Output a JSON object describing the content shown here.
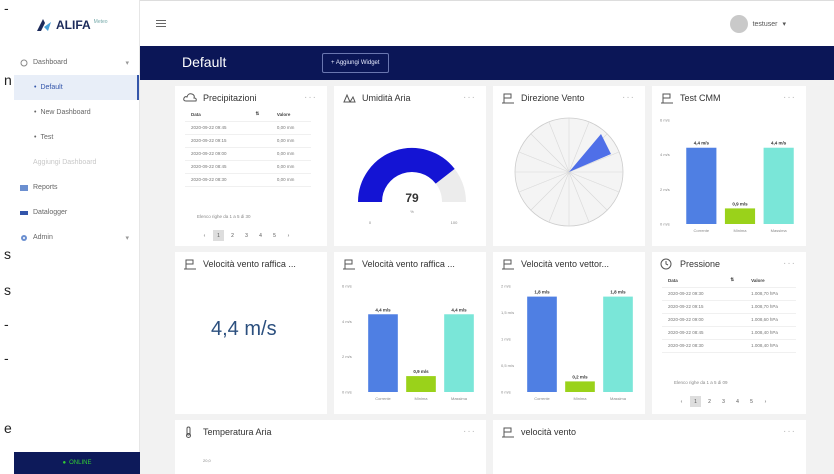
{
  "edge_glyphs": [
    "-",
    "n",
    "s",
    "s",
    "-",
    "-",
    "e"
  ],
  "brand": {
    "name": "ALIFA",
    "sup": "Meteo"
  },
  "sidebar": {
    "items": [
      {
        "label": "Dashboard",
        "icon": "dashboard-icon",
        "has_chevron": true
      },
      {
        "label": "Default",
        "active": true
      },
      {
        "label": "New Dashboard"
      },
      {
        "label": "Test"
      },
      {
        "label": "Aggiungi Dashboard",
        "disabled": true
      },
      {
        "label": "Reports",
        "icon": "reports-icon"
      },
      {
        "label": "Datalogger",
        "icon": "datalogger-icon"
      },
      {
        "label": "Admin",
        "icon": "admin-icon",
        "has_chevron": true
      }
    ],
    "status": "ONLINE"
  },
  "topbar": {
    "user": "testuser",
    "user_caret": "▾"
  },
  "dashboard": {
    "title": "Default",
    "add_widget": "+ Aggiungi Widget"
  },
  "widgets": {
    "precipitazioni": {
      "title": "Precipitazioni",
      "columns": [
        "Data",
        "Valore"
      ],
      "rows": [
        [
          "2020-09-22 09:45",
          "0,00 mm"
        ],
        [
          "2020-09-22 09:15",
          "0,00 mm"
        ],
        [
          "2020-09-22 09:00",
          "0,00 mm"
        ],
        [
          "2020-09-22 08:45",
          "0,00 mm"
        ],
        [
          "2020-09-22 08:30",
          "0,00 mm"
        ]
      ],
      "info": "Elenco righe da 1 a 5 di 30",
      "pages": [
        "‹",
        "1",
        "2",
        "3",
        "4",
        "5",
        "›"
      ]
    },
    "umidita": {
      "title": "Umidità Aria",
      "value": "79",
      "unit": "%",
      "min": "0",
      "max": "100",
      "gauge_fraction": 0.79
    },
    "direzione": {
      "title": "Direzione Vento"
    },
    "test_cmm": {
      "title": "Test CMM",
      "bar_labels": [
        "4,4 m/s",
        "0,9 m/s",
        "4,4 m/s"
      ],
      "categories": [
        "Corrente",
        "Minima",
        "Massima"
      ],
      "yticks": [
        "6 m/s",
        "4 m/s",
        "2 m/s",
        "0 m/s"
      ]
    },
    "raffica1": {
      "title": "Velocità vento raffica ...",
      "value": "4,4 m/s"
    },
    "raffica2": {
      "title": "Velocità vento raffica ...",
      "bar_labels": [
        "4,4 m/s",
        "0,9 m/s",
        "4,4 m/s"
      ],
      "categories": [
        "Corrente",
        "Minima",
        "Massima"
      ],
      "yticks": [
        "6 m/s",
        "4 m/s",
        "2 m/s",
        "0 m/s"
      ]
    },
    "vettore": {
      "title": "Velocità vento vettor...",
      "bar_labels": [
        "1,8 m/s",
        "0,2 m/s",
        "1,8 m/s"
      ],
      "categories": [
        "Corrente",
        "Minima",
        "Massima"
      ],
      "yticks": [
        "2 m/s",
        "1,5 m/s",
        "1 m/s",
        "0,5 m/s",
        "0 m/s"
      ]
    },
    "pressione": {
      "title": "Pressione",
      "columns": [
        "Data",
        "Valore"
      ],
      "rows": [
        [
          "2020-09-22 09:30",
          "1.008,70 hPa"
        ],
        [
          "2020-09-22 09:15",
          "1.008,70 hPa"
        ],
        [
          "2020-09-22 09:00",
          "1.008,60 hPa"
        ],
        [
          "2020-09-22 08:45",
          "1.008,40 hPa"
        ],
        [
          "2020-09-22 08:30",
          "1.008,40 hPa"
        ]
      ],
      "info": "Elenco righe da 1 a 5 di 09",
      "pages": [
        "‹",
        "1",
        "2",
        "3",
        "4",
        "5",
        "›"
      ]
    },
    "temperatura": {
      "title": "Temperatura Aria",
      "ytick": "20,0"
    },
    "velocita": {
      "title": "velocità vento"
    }
  },
  "chart_data": [
    {
      "type": "bar",
      "title": "Test CMM",
      "categories": [
        "Corrente",
        "Minima",
        "Massima"
      ],
      "values": [
        4.4,
        0.9,
        4.4
      ],
      "ylim": [
        0,
        6
      ],
      "colors": [
        "#4f7fe3",
        "#9ad21a",
        "#7ae6d8"
      ]
    },
    {
      "type": "bar",
      "title": "Velocità vento raffica ...",
      "categories": [
        "Corrente",
        "Minima",
        "Massima"
      ],
      "values": [
        4.4,
        0.9,
        4.4
      ],
      "ylim": [
        0,
        6
      ],
      "colors": [
        "#4f7fe3",
        "#9ad21a",
        "#7ae6d8"
      ]
    },
    {
      "type": "bar",
      "title": "Velocità vento vettor...",
      "categories": [
        "Corrente",
        "Minima",
        "Massima"
      ],
      "values": [
        1.8,
        0.2,
        1.8
      ],
      "ylim": [
        0,
        2
      ],
      "colors": [
        "#4f7fe3",
        "#9ad21a",
        "#7ae6d8"
      ]
    }
  ],
  "colors": {
    "navy": "#0b1657",
    "accent": "#3355aa",
    "gauge": "#1414d4"
  }
}
